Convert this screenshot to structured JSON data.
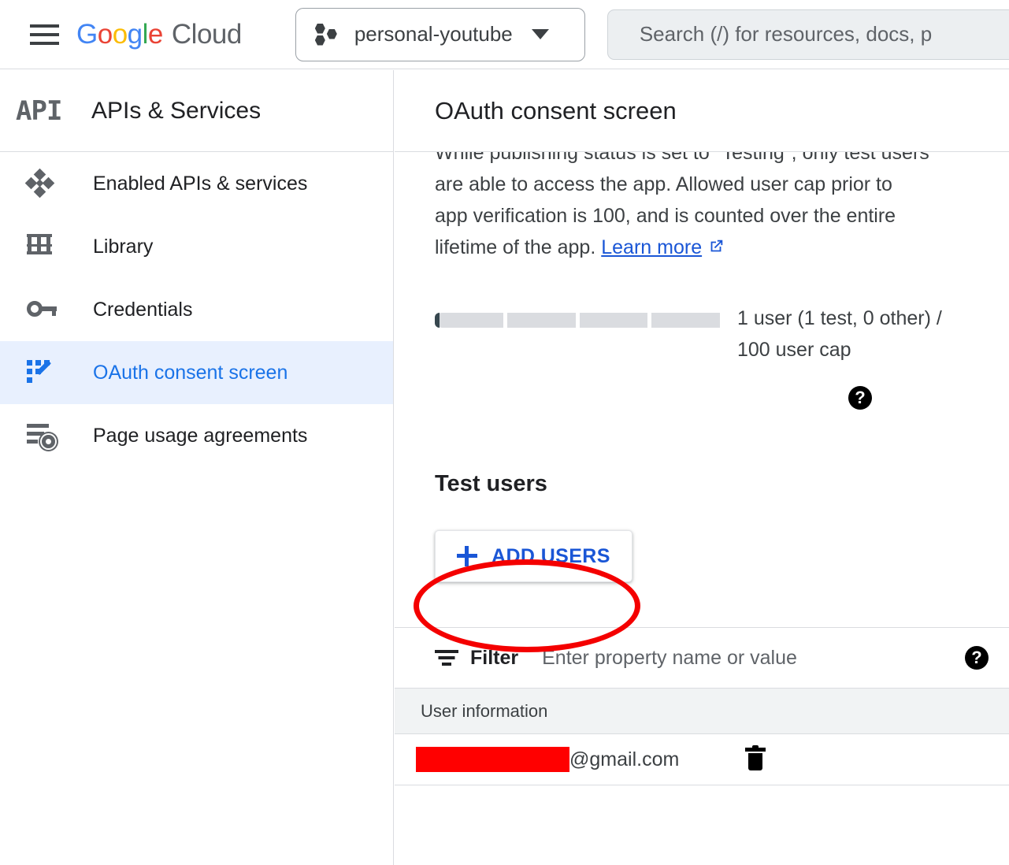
{
  "topbar": {
    "menu_icon": "hamburger-menu-icon",
    "brand": {
      "g1": "G",
      "g2": "o",
      "g3": "o",
      "g4": "g",
      "g5": "l",
      "g6": "e",
      "cloud": "Cloud"
    },
    "project_selector": {
      "name": "personal-youtube",
      "icon": "project-hexagons-icon",
      "caret": "chevron-down-icon"
    },
    "search": {
      "placeholder": "Search (/) for resources, docs, p",
      "value": ""
    }
  },
  "sidebar": {
    "logo_text": "API",
    "title": "APIs & Services",
    "items": [
      {
        "label": "Enabled APIs & services",
        "icon": "diamond-cluster-icon",
        "active": false
      },
      {
        "label": "Library",
        "icon": "library-icon",
        "active": false
      },
      {
        "label": "Credentials",
        "icon": "key-icon",
        "active": false
      },
      {
        "label": "OAuth consent screen",
        "icon": "oauth-consent-icon",
        "active": true
      },
      {
        "label": "Page usage agreements",
        "icon": "page-usage-icon",
        "active": false
      }
    ]
  },
  "main": {
    "page_title": "OAuth consent screen",
    "notice": {
      "line1": "While publishing status is set to \"Testing\", only test",
      "text": "users are able to access the app. Allowed user cap prior to app verification is 100, and is counted over the entire lifetime of the app.",
      "link_label": "Learn more",
      "link_icon": "external-link-icon"
    },
    "user_cap": {
      "progress_percent": 1,
      "segments": 4,
      "text": "1 user (1 test, 0 other) / 100 user cap"
    },
    "help_icon": "help-circle-icon",
    "test_users": {
      "heading": "Test users",
      "add_button_label": "ADD USERS",
      "add_button_icon": "plus-icon",
      "annotation": {
        "shape": "ellipse",
        "color": "#f40000"
      }
    },
    "filter": {
      "icon": "filter-icon",
      "label": "Filter",
      "placeholder": "Enter property name or value",
      "value": "",
      "help_icon": "help-circle-icon"
    },
    "table": {
      "columns": [
        "User information"
      ],
      "rows": [
        {
          "email_redacted": true,
          "email_suffix": "@gmail.com",
          "delete_icon": "trash-icon"
        }
      ]
    }
  },
  "colors": {
    "accent_blue": "#1a73e8",
    "link_blue": "#1a56d6",
    "active_nav_bg": "#e8f0fe",
    "annotation_red": "#f40000",
    "redaction_red": "#ff0000",
    "table_header_bg": "#f1f3f4"
  }
}
